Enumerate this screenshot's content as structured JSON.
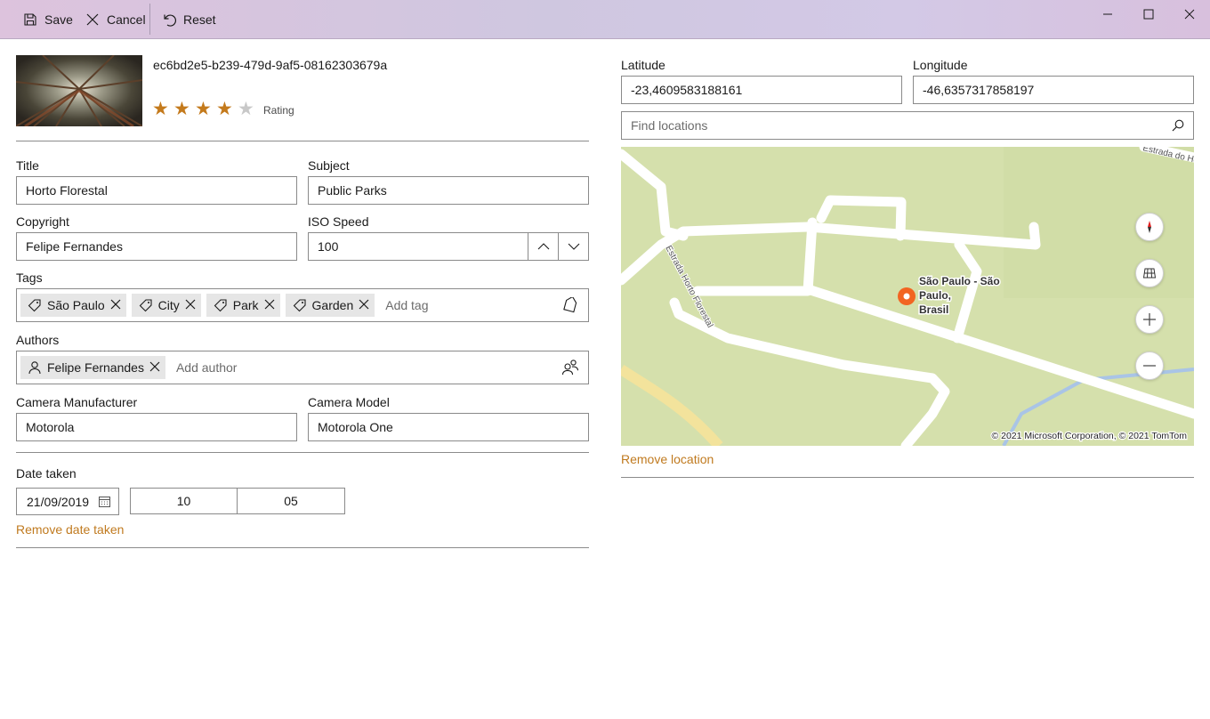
{
  "toolbar": {
    "save_label": "Save",
    "cancel_label": "Cancel",
    "reset_label": "Reset"
  },
  "photo": {
    "id": "ec6bd2e5-b239-479d-9af5-08162303679a",
    "rating_label": "Rating",
    "rating_value": 4,
    "rating_max": 5
  },
  "form": {
    "title_label": "Title",
    "title_value": "Horto Florestal",
    "subject_label": "Subject",
    "subject_value": "Public Parks",
    "copyright_label": "Copyright",
    "copyright_value": "Felipe Fernandes",
    "iso_label": "ISO Speed",
    "iso_value": "100",
    "tags_label": "Tags",
    "tags": [
      "São Paulo",
      "City",
      "Park",
      "Garden"
    ],
    "tag_placeholder": "Add tag",
    "authors_label": "Authors",
    "authors": [
      "Felipe Fernandes"
    ],
    "author_placeholder": "Add author",
    "manufacturer_label": "Camera Manufacturer",
    "manufacturer_value": "Motorola",
    "model_label": "Camera Model",
    "model_value": "Motorola One",
    "date_label": "Date taken",
    "date_value": "21/09/2019",
    "hour_value": "10",
    "minute_value": "05",
    "remove_date_label": "Remove date taken"
  },
  "location": {
    "latitude_label": "Latitude",
    "latitude_value": "-23,4609583188161",
    "longitude_label": "Longitude",
    "longitude_value": "-46,6357317858197",
    "search_placeholder": "Find locations",
    "pin_label_line1": "São Paulo - São",
    "pin_label_line2": "Paulo,",
    "pin_label_line3": "Brasil",
    "street_label_1": "Estrada Horto Florestal",
    "street_label_2": "Estrada do Horto",
    "copyright": "© 2021 Microsoft Corporation, © 2021 TomTom",
    "remove_label": "Remove location"
  },
  "colors": {
    "accent": "#c07a1f",
    "star_filled": "#c47a1c",
    "star_empty": "#c8c8c8",
    "map_land": "#d5e0ac",
    "pin": "#f26522"
  }
}
